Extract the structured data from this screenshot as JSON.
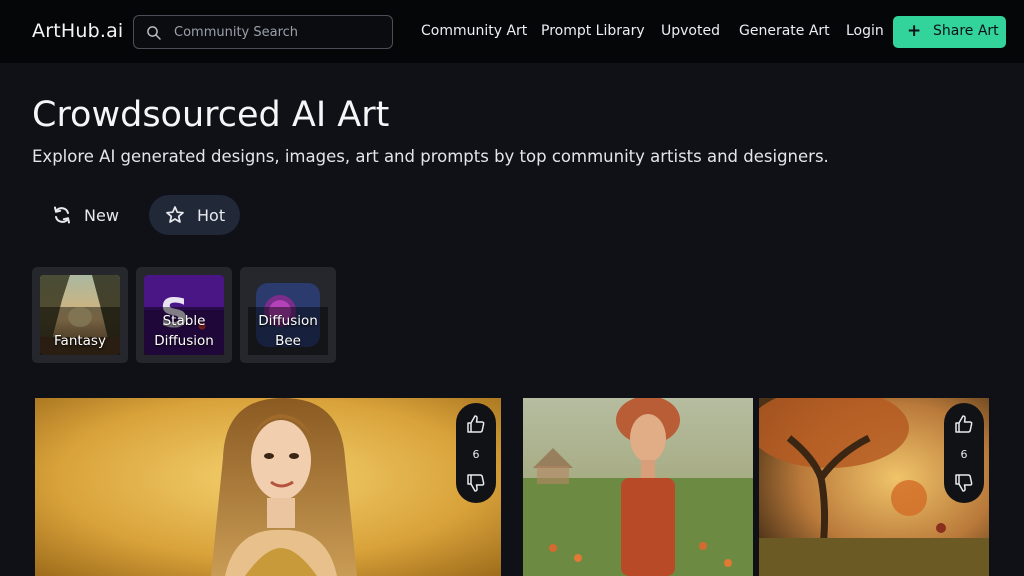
{
  "header": {
    "logo": "ArtHub.ai",
    "search_placeholder": "Community Search",
    "nav": [
      "Community Art",
      "Prompt Library",
      "Upvoted",
      "Generate Art",
      "Login"
    ],
    "share_label": "Share Art"
  },
  "hero": {
    "title": "Crowdsourced AI Art",
    "subtitle": "Explore AI generated designs, images, art and prompts by top community artists and designers."
  },
  "sort": {
    "new_label": "New",
    "hot_label": "Hot",
    "active": "Hot"
  },
  "categories": [
    {
      "label_line1": "",
      "label_line2": "Fantasy"
    },
    {
      "label_line1": "Stable",
      "label_line2": "Diffusion"
    },
    {
      "label_line1": "Diffusion",
      "label_line2": "Bee"
    }
  ],
  "gallery": [
    {
      "votes": "6"
    },
    {
      "votes": ""
    },
    {
      "votes": "6"
    }
  ],
  "colors": {
    "accent": "#33d39c",
    "background": "#0f1117",
    "header": "#050608",
    "active_pill": "#212838"
  }
}
